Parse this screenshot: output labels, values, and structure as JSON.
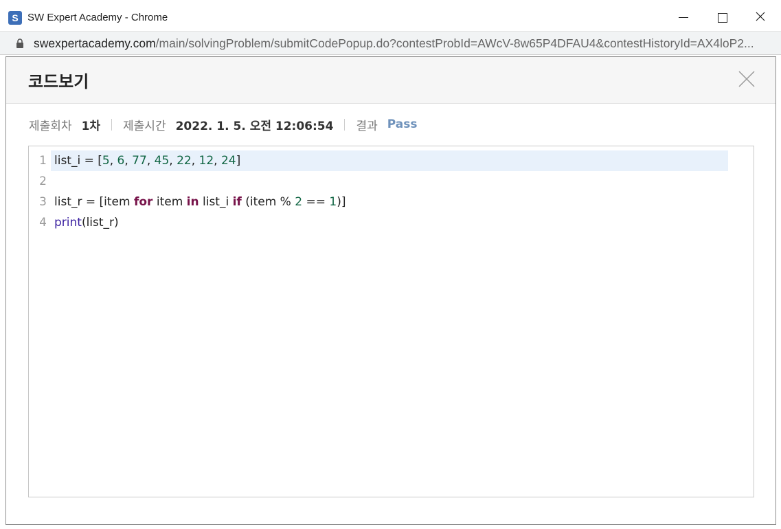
{
  "window": {
    "title": "SW Expert Academy - Chrome",
    "favicon_letter": "S"
  },
  "address_bar": {
    "url_host": "swexpertacademy.com",
    "url_path": "/main/solvingProblem/submitCodePopup.do?contestProbId=AWcV-8w65P4DFAU4&contestHistoryId=AX4loP2..."
  },
  "modal": {
    "title": "코드보기",
    "meta": {
      "submission_label": "제출회차",
      "submission_value": "1차",
      "time_label": "제출시간",
      "time_value": "2022. 1. 5. 오전 12:06:54",
      "result_label": "결과",
      "result_value": "Pass"
    },
    "code_lines": [
      {
        "num": "1",
        "tokens": [
          {
            "t": "list_i = [",
            "c": ""
          },
          {
            "t": "5",
            "c": "num"
          },
          {
            "t": ", ",
            "c": ""
          },
          {
            "t": "6",
            "c": "num"
          },
          {
            "t": ", ",
            "c": ""
          },
          {
            "t": "77",
            "c": "num"
          },
          {
            "t": ", ",
            "c": ""
          },
          {
            "t": "45",
            "c": "num"
          },
          {
            "t": ", ",
            "c": ""
          },
          {
            "t": "22",
            "c": "num"
          },
          {
            "t": ", ",
            "c": ""
          },
          {
            "t": "12",
            "c": "num"
          },
          {
            "t": ", ",
            "c": ""
          },
          {
            "t": "24",
            "c": "num"
          },
          {
            "t": "]",
            "c": ""
          }
        ]
      },
      {
        "num": "2",
        "tokens": []
      },
      {
        "num": "3",
        "tokens": [
          {
            "t": "list_r = [item ",
            "c": ""
          },
          {
            "t": "for",
            "c": "kw"
          },
          {
            "t": " item ",
            "c": ""
          },
          {
            "t": "in",
            "c": "kw"
          },
          {
            "t": " list_i ",
            "c": ""
          },
          {
            "t": "if",
            "c": "kw"
          },
          {
            "t": " (item % ",
            "c": ""
          },
          {
            "t": "2",
            "c": "num"
          },
          {
            "t": " == ",
            "c": ""
          },
          {
            "t": "1",
            "c": "num"
          },
          {
            "t": ")]",
            "c": ""
          }
        ]
      },
      {
        "num": "4",
        "tokens": [
          {
            "t": "print",
            "c": "bi"
          },
          {
            "t": "(list_r)",
            "c": ""
          }
        ]
      }
    ],
    "active_line": 1
  },
  "colors": {
    "pass": "#6f92bb",
    "keyword": "#77134a",
    "number": "#116644",
    "builtin": "#3a1fa0",
    "active_line_bg": "#e8f1fb"
  },
  "icons": {
    "favicon": "sw-logo-icon",
    "lock": "lock-icon",
    "minimize": "minimize-icon",
    "maximize": "maximize-icon",
    "close": "close-icon",
    "modal_close": "close-x-icon"
  }
}
